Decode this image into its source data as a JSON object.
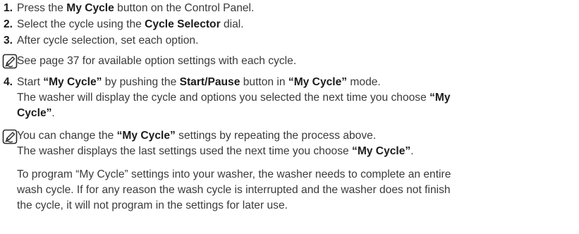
{
  "steps": [
    {
      "num": "1.",
      "pre": "Press the ",
      "bold1": "My Cycle",
      "post": " button on the Control Panel."
    },
    {
      "num": "2.",
      "pre": "Select the cycle using the ",
      "bold1": "Cycle Selector",
      "post": " dial."
    },
    {
      "num": "3.",
      "text": "After cycle selection, set each option."
    },
    {
      "num": "4.",
      "line1_pre": "Start ",
      "line1_b1": "“My Cycle”",
      "line1_mid": " by pushing the ",
      "line1_b2": "Start/Pause",
      "line1_mid2": " button in ",
      "line1_b3": "“My Cycle”",
      "line1_post": " mode.",
      "line2_pre": "The washer will display the cycle and options you selected the next time you choose ",
      "line2_b": "“My",
      "line3_b": "Cycle”",
      "line3_post": "."
    }
  ],
  "note1": {
    "icon": "note-pencil-icon",
    "text": "See page 37 for available option settings with each cycle."
  },
  "note2": {
    "icon": "note-pencil-icon",
    "line1_pre": "You can change the ",
    "line1_b": "“My Cycle”",
    "line1_post": " settings by repeating the process above.",
    "line2_pre": "The washer displays the last settings used the next time you choose ",
    "line2_b": "“My Cycle”",
    "line2_post": "."
  },
  "paragraph": {
    "line1": "To program “My Cycle” settings into your washer, the washer needs to complete an entire",
    "line2": "wash cycle. If for any reason the wash cycle is interrupted and the washer does not finish",
    "line3": "the cycle, it will not program in the settings for later use."
  }
}
